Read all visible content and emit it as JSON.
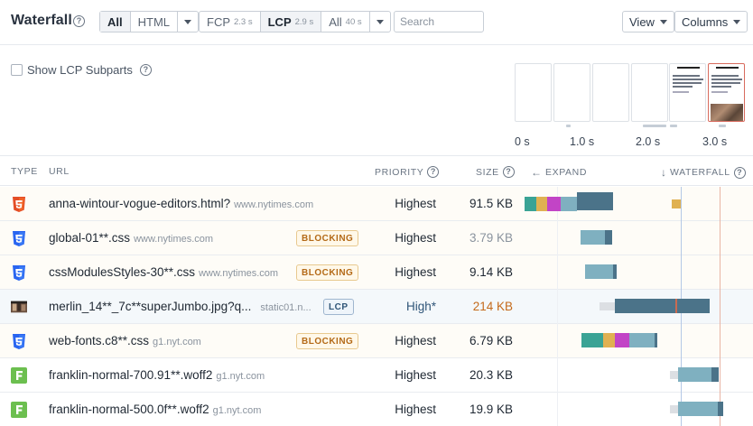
{
  "toolbar": {
    "title": "Waterfall",
    "filter_all": "All",
    "filter_html": "HTML",
    "metric_fcp": "FCP",
    "metric_fcp_time": "2.3 s",
    "metric_lcp": "LCP",
    "metric_lcp_time": "2.9 s",
    "metric_all": "All",
    "metric_all_time": "40 s",
    "search_placeholder": "Search",
    "view_label": "View",
    "columns_label": "Columns"
  },
  "lcp_subparts": {
    "label": "Show LCP Subparts",
    "checked": false
  },
  "filmstrip": {
    "ticks": [
      "0 s",
      "1.0 s",
      "2.0 s",
      "3.0 s"
    ]
  },
  "table": {
    "headers": {
      "type": "TYPE",
      "url": "URL",
      "priority": "PRIORITY",
      "size": "SIZE",
      "expand": "EXPAND",
      "waterfall": "WATERFALL"
    },
    "rows": [
      {
        "icon": "html5-icon",
        "name": "anna-wintour-vogue-editors.html?",
        "host": "www.nytimes.com",
        "badge": "",
        "priority": "Highest",
        "size": "91.5 KB"
      },
      {
        "icon": "css3-icon",
        "name": "global-01**.css",
        "host": "www.nytimes.com",
        "badge": "BLOCKING",
        "priority": "Highest",
        "size": "3.79 KB"
      },
      {
        "icon": "css3-icon",
        "name": "cssModulesStyles-30**.css",
        "host": "www.nytimes.com",
        "badge": "BLOCKING",
        "priority": "Highest",
        "size": "9.14 KB"
      },
      {
        "icon": "image-thumbnail-icon",
        "name": "merlin_14**_7c**superJumbo.jpg?q...",
        "host": "static01.n...",
        "badge": "LCP",
        "priority": "High*",
        "size": "214 KB"
      },
      {
        "icon": "css3-icon",
        "name": "web-fonts.c8**.css",
        "host": "g1.nyt.com",
        "badge": "BLOCKING",
        "priority": "Highest",
        "size": "6.79 KB"
      },
      {
        "icon": "font-icon",
        "name": "franklin-normal-700.91**.woff2",
        "host": "g1.nyt.com",
        "badge": "",
        "priority": "Highest",
        "size": "20.3 KB"
      },
      {
        "icon": "font-icon",
        "name": "franklin-normal-500.0f**.woff2",
        "host": "g1.nyt.com",
        "badge": "",
        "priority": "Highest",
        "size": "19.9 KB"
      }
    ]
  },
  "colors": {
    "dns": "#3aa395",
    "connect": "#e0b152",
    "ssl": "#c244c6",
    "wait": "#7fb0c0",
    "download": "#4b7389",
    "html_icon": "#e44d26",
    "css_icon": "#2965f1",
    "font_icon": "#6cbf4f",
    "lcp_marker": "#c96b52",
    "fcp_marker": "#b4c8e6"
  }
}
